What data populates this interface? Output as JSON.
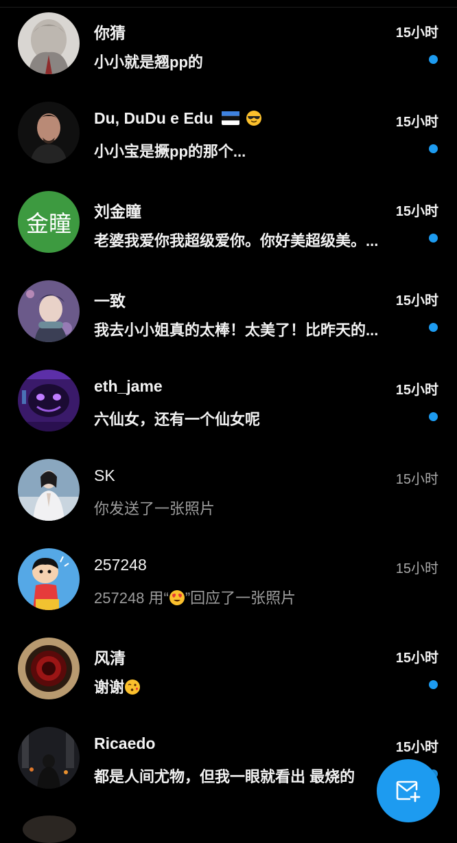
{
  "conversations": [
    {
      "name": "你猜",
      "time": "15小时",
      "preview": "小小就是翘pp的",
      "unread": true
    },
    {
      "name": "Du, DuDu e Edu",
      "time": "15小时",
      "preview": "小小宝是撅pp的那个...",
      "unread": true
    },
    {
      "name": "刘金瞳",
      "time": "15小时",
      "preview": "老婆我爱你我超级爱你。你好美超级美。...",
      "unread": true,
      "avatar_text": "金瞳"
    },
    {
      "name": "一致",
      "time": "15小时",
      "preview": "我去小小姐真的太棒！太美了！比昨天的...",
      "unread": true
    },
    {
      "name": "eth_jame",
      "time": "15小时",
      "preview": "六仙女，还有一个仙女呢",
      "unread": true
    },
    {
      "name": "SK",
      "time": "15小时",
      "preview": "你发送了一张照片",
      "unread": false
    },
    {
      "name": "257248",
      "time": "15小时",
      "preview_before": "257248 用“",
      "preview_after": "”回应了一张照片",
      "unread": false
    },
    {
      "name": "风清",
      "time": "15小时",
      "preview": "谢谢",
      "unread": true
    },
    {
      "name": "Ricaedo",
      "time": "15小时",
      "preview": "都是人间尤物，但我一眼就看出 最烧的",
      "unread": true
    }
  ],
  "colors": {
    "accent": "#1d9bf0",
    "background": "#000000",
    "avatar_green": "#3d9a40"
  },
  "icons": {
    "flag": "estonia-flag-icon",
    "sunglasses": "sunglasses-emoji-icon",
    "heart_eyes": "heart-eyes-emoji-icon",
    "kiss": "kissing-heart-emoji-icon",
    "fab": "new-message-icon"
  }
}
